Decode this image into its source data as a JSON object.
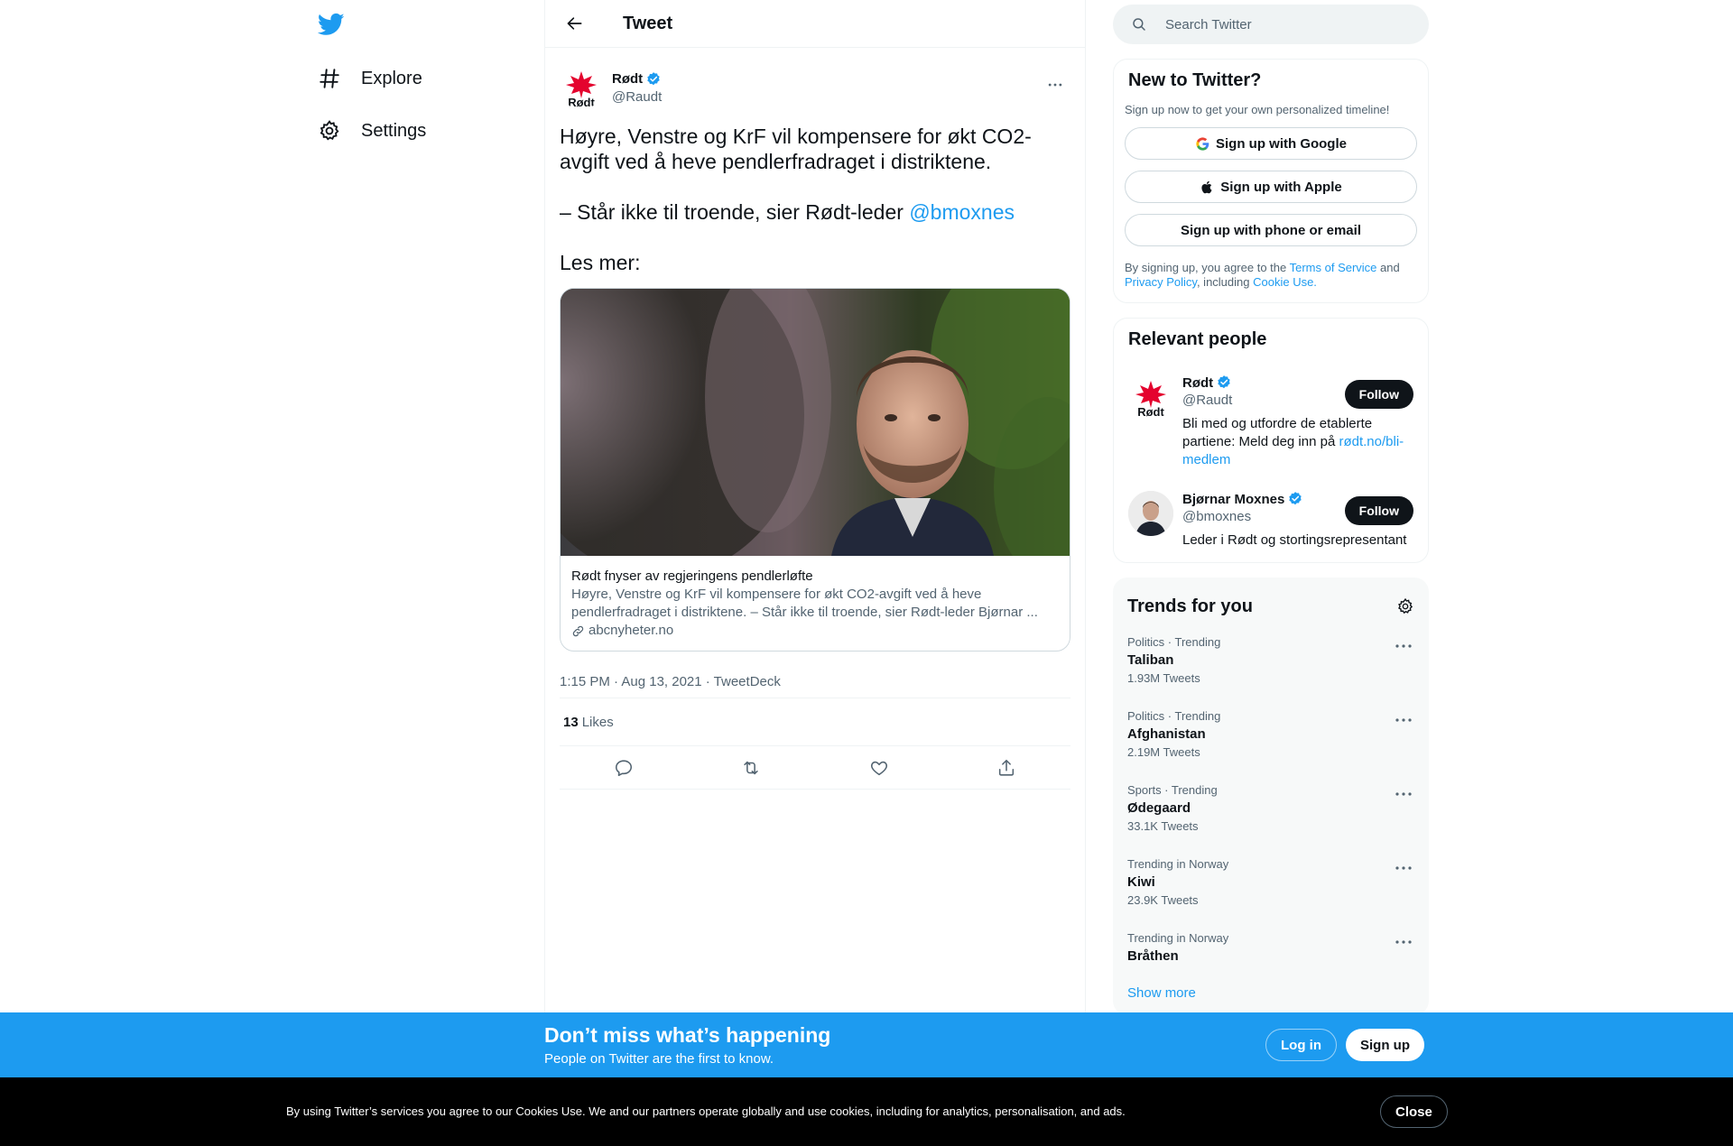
{
  "nav": {
    "explore_label": "Explore",
    "settings_label": "Settings"
  },
  "header": {
    "title": "Tweet"
  },
  "tweet": {
    "author_name": "Rødt",
    "author_handle": "@Raudt",
    "text_part1": "Høyre, Venstre og KrF vil kompensere for økt CO2-avgift ved å heve pendlerfradraget i distriktene.\n\n– Står ikke til troende, sier Rødt-leder ",
    "mention": "@bmoxnes",
    "text_part2": "\n\nLes mer:",
    "card": {
      "title": "Rødt fnyser av regjeringens pendlerløfte",
      "description": "Høyre, Venstre og KrF vil kompensere for økt CO2-avgift ved å heve pendlerfradraget i distriktene. – Står ikke til troende, sier Rødt-leder Bjørnar ...",
      "domain": "abcnyheter.no"
    },
    "meta": "1:15 PM · Aug 13, 2021 · TweetDeck",
    "likes_count": "13",
    "likes_label": "Likes"
  },
  "search": {
    "placeholder": "Search Twitter"
  },
  "new_to_twitter": {
    "title": "New to Twitter?",
    "subtitle": "Sign up now to get your own personalized timeline!",
    "google_label": "Sign up with Google",
    "apple_label": "Sign up with Apple",
    "phone_label": "Sign up with phone or email",
    "terms_1": "By signing up, you agree to the ",
    "terms_link": "Terms of Service",
    "terms_2": " and ",
    "privacy_link": "Privacy Policy",
    "terms_3": ", including ",
    "cookie_link": "Cookie Use."
  },
  "relevant_people": {
    "title": "Relevant people",
    "people": [
      {
        "name": "Rødt",
        "handle": "@Raudt",
        "bio": "Bli med og utfordre de etablerte partiene: Meld deg inn på ",
        "bio_link": "rødt.no/bli-medlem",
        "follow_label": "Follow"
      },
      {
        "name": "Bjørnar Moxnes",
        "handle": "@bmoxnes",
        "bio": "Leder i Rødt og stortingsrepresentant",
        "bio_link": "",
        "follow_label": "Follow"
      }
    ]
  },
  "trends": {
    "title": "Trends for you",
    "items": [
      {
        "category": "Politics · Trending",
        "name": "Taliban",
        "count": "1.93M Tweets"
      },
      {
        "category": "Politics · Trending",
        "name": "Afghanistan",
        "count": "2.19M Tweets"
      },
      {
        "category": "Sports · Trending",
        "name": "Ødegaard",
        "count": "33.1K Tweets"
      },
      {
        "category": "Trending in Norway",
        "name": "Kiwi",
        "count": "23.9K Tweets"
      },
      {
        "category": "Trending in Norway",
        "name": "Bråthen",
        "count": ""
      }
    ],
    "show_more": "Show more"
  },
  "bottom_bar": {
    "title": "Don’t miss what’s happening",
    "subtitle": "People on Twitter are the first to know.",
    "login_label": "Log in",
    "signup_label": "Sign up"
  },
  "cookie_bar": {
    "text": "By using Twitter’s services you agree to our Cookies Use. We and our partners operate globally and use cookies, including for analytics, personalisation, and ads.",
    "close_label": "Close"
  },
  "colors": {
    "accent": "#1d9bf0",
    "text": "#0f1419",
    "muted": "#536471",
    "rodt_red": "#e4032e"
  }
}
